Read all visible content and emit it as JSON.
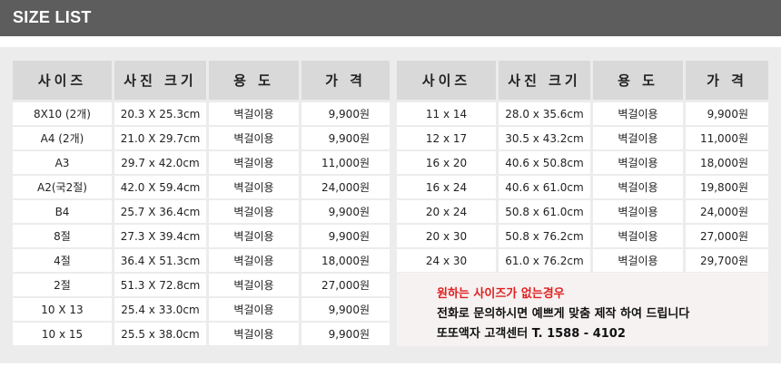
{
  "header": {
    "title": "SIZE LIST"
  },
  "left_table": {
    "columns": [
      "사이즈",
      "사진 크기",
      "용 도",
      "가 격"
    ],
    "rows": [
      [
        "8X10 (2개)",
        "20.3 X 25.3cm",
        "벽걸이용",
        "9,900원"
      ],
      [
        "A4 (2개)",
        "21.0 X 29.7cm",
        "벽걸이용",
        "9,900원"
      ],
      [
        "A3",
        "29.7 x 42.0cm",
        "벽걸이용",
        "11,000원"
      ],
      [
        "A2(국2절)",
        "42.0 X 59.4cm",
        "벽걸이용",
        "24,000원"
      ],
      [
        "B4",
        "25.7 X 36.4cm",
        "벽걸이용",
        "9,900원"
      ],
      [
        "8절",
        "27.3 X 39.4cm",
        "벽걸이용",
        "9,900원"
      ],
      [
        "4절",
        "36.4 X 51.3cm",
        "벽걸이용",
        "18,000원"
      ],
      [
        "2절",
        "51.3 X 72.8cm",
        "벽걸이용",
        "27,000원"
      ],
      [
        "10 X 13",
        "25.4 x 33.0cm",
        "벽걸이용",
        "9,900원"
      ],
      [
        "10 x 15",
        "25.5 x 38.0cm",
        "벽걸이용",
        "9,900원"
      ]
    ]
  },
  "right_table": {
    "columns": [
      "사이즈",
      "사진 크기",
      "용 도",
      "가 격"
    ],
    "rows": [
      [
        "11 x 14",
        "28.0 x 35.6cm",
        "벽걸이용",
        "9,900원"
      ],
      [
        "12 x 17",
        "30.5 x 43.2cm",
        "벽걸이용",
        "11,000원"
      ],
      [
        "16 x 20",
        "40.6 x 50.8cm",
        "벽걸이용",
        "18,000원"
      ],
      [
        "16 x 24",
        "40.6 x 61.0cm",
        "벽걸이용",
        "19,800원"
      ],
      [
        "20 x 24",
        "50.8 x 61.0cm",
        "벽걸이용",
        "24,000원"
      ],
      [
        "20 x 30",
        "50.8 x 76.2cm",
        "벽걸이용",
        "27,000원"
      ],
      [
        "24 x 30",
        "61.0 x 76.2cm",
        "벽걸이용",
        "29,700원"
      ]
    ]
  },
  "notice": {
    "headline": "원하는 사이즈가 없는경우",
    "line1": "전화로 문의하시면 예쁘게 맞춤 제작 하여 드립니다",
    "line2": "또또액자 고객센터   T. 1588 - 4102",
    "headline_color": "#e02020"
  }
}
